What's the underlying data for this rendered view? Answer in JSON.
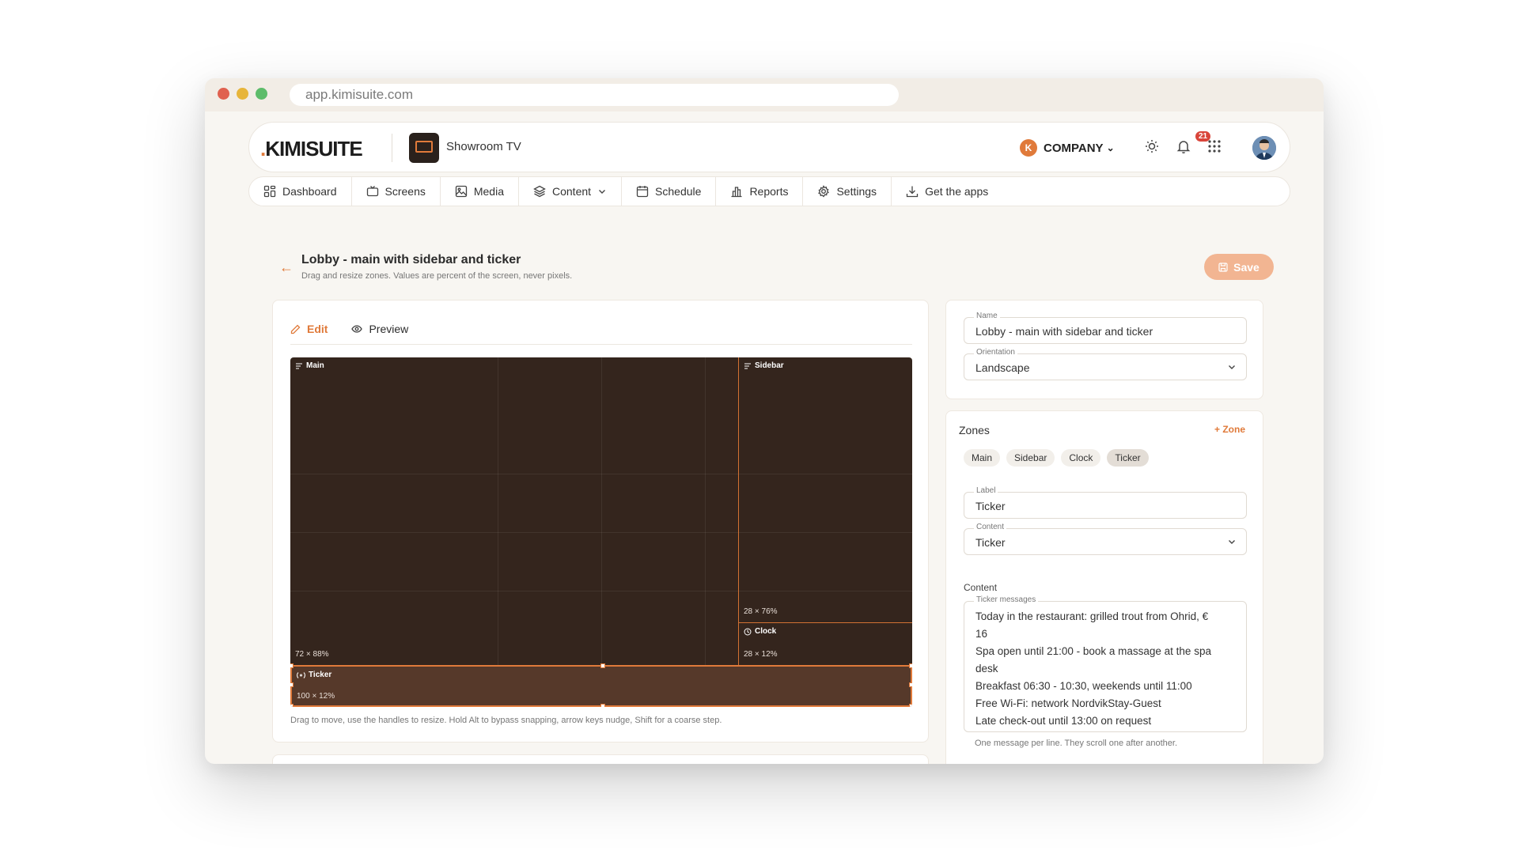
{
  "browser": {
    "url": "app.kimisuite.com"
  },
  "header": {
    "logo": "KIMISUITE",
    "screen_name": "Showroom TV",
    "company_initial": "K",
    "company_label": "COMPANY",
    "notifications_count": "21"
  },
  "nav": [
    {
      "label": "Dashboard",
      "icon": "dashboard-icon"
    },
    {
      "label": "Screens",
      "icon": "tv-icon"
    },
    {
      "label": "Media",
      "icon": "image-icon"
    },
    {
      "label": "Content",
      "icon": "layers-icon"
    },
    {
      "label": "Schedule",
      "icon": "calendar-icon"
    },
    {
      "label": "Reports",
      "icon": "bar-chart-icon"
    },
    {
      "label": "Settings",
      "icon": "gear-icon"
    },
    {
      "label": "Get the apps",
      "icon": "download-icon"
    }
  ],
  "page": {
    "title": "Lobby - main with sidebar and ticker",
    "subtitle": "Drag and resize zones. Values are percent of the screen, never pixels.",
    "save_label": "Save"
  },
  "editor": {
    "tab_edit": "Edit",
    "tab_preview": "Preview",
    "hint": "Drag to move, use the handles to resize. Hold Alt to bypass snapping, arrow keys nudge, Shift for a coarse step.",
    "zones": [
      {
        "label": "Main",
        "dims": "72 × 88%"
      },
      {
        "label": "Sidebar",
        "dims": "28 × 76%"
      },
      {
        "label": "Clock",
        "dims": "28 × 12%"
      },
      {
        "label": "Ticker",
        "dims": "100 × 12%"
      }
    ]
  },
  "settings": {
    "name_label": "Name",
    "name_value": "Lobby - main with sidebar and ticker",
    "orientation_label": "Orientation",
    "orientation_value": "Landscape"
  },
  "zones_panel": {
    "title": "Zones",
    "add_label": "Zone",
    "chips": [
      "Main",
      "Sidebar",
      "Clock",
      "Ticker"
    ],
    "label_label": "Label",
    "label_value": "Ticker",
    "content_label": "Content",
    "content_value": "Ticker",
    "content_heading": "Content",
    "messages_label": "Ticker messages",
    "messages": [
      "Today in the restaurant: grilled trout from Ohrid, €",
      "16",
      "Spa open until 21:00 - book a massage at the spa",
      "desk",
      "Breakfast 06:30 - 10:30, weekends until 11:00",
      "Free Wi-Fi: network NordvikStay-Guest",
      "Late check-out until 13:00 on request"
    ],
    "messages_help": "One message per line. They scroll one after another."
  },
  "colors": {
    "accent": "#e07a3a",
    "canvas": "#34251d",
    "selected_zone": "#56392a"
  }
}
